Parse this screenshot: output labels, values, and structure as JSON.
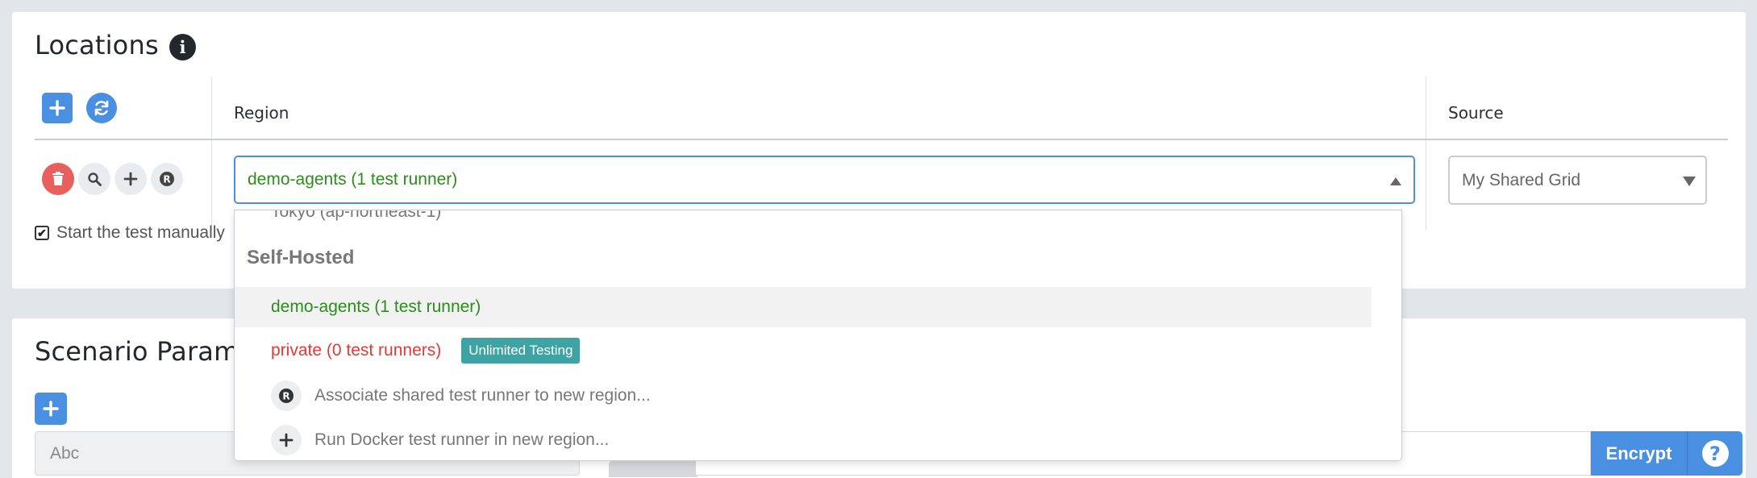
{
  "locations": {
    "title": "Locations",
    "info_icon": "info-circle-icon",
    "columns": {
      "region": "Region",
      "source": "Source"
    },
    "row": {
      "region_value": "demo-agents (1 test runner)",
      "source_value": "My Shared Grid",
      "action_icons": [
        "trash-icon",
        "search-icon",
        "plus-icon",
        "registered-icon"
      ]
    },
    "checkbox_label": "Start the test manually"
  },
  "dropdown": {
    "cut_off_item": "Tokyo (ap-northeast-1)",
    "group_label": "Self-Hosted",
    "items": [
      {
        "label": "demo-agents (1 test runner)",
        "state": "selected"
      },
      {
        "label": "private (0 test runners)",
        "state": "unavailable",
        "badge": "Unlimited Testing"
      }
    ],
    "actions": [
      {
        "icon": "registered-icon",
        "label": "Associate shared test runner to new region..."
      },
      {
        "icon": "plus-icon",
        "label": "Run Docker test runner in new region..."
      }
    ]
  },
  "scenario": {
    "title": "Scenario Param",
    "field_placeholder": "Abc",
    "encrypt_label": "Encrypt",
    "help_icon": "question-circle-icon"
  },
  "colors": {
    "accent": "#4a90e2",
    "success_text": "#2e8b1e",
    "danger_text": "#e53935",
    "badge": "#40a3a3",
    "danger_button": "#e8605d"
  }
}
